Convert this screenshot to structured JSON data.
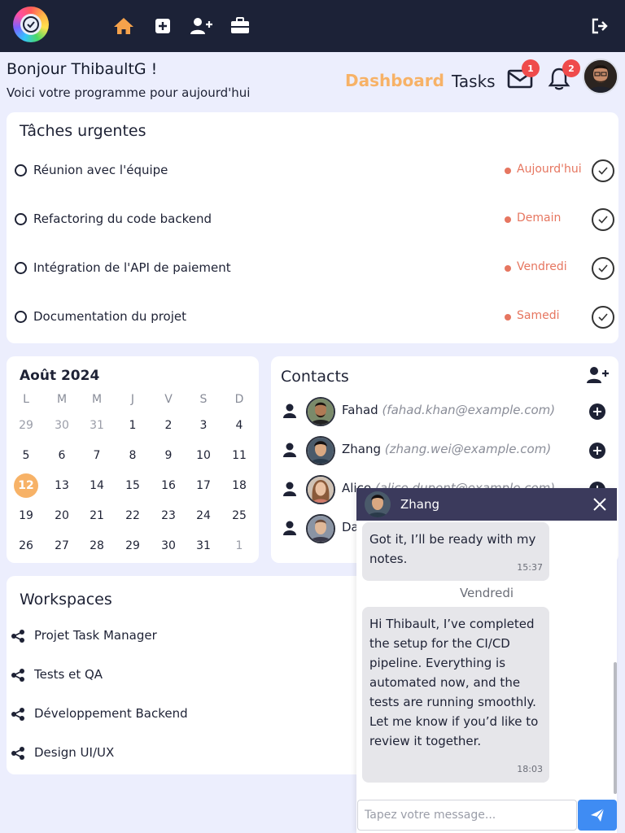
{
  "navbar": {
    "icons": [
      "logo-icon",
      "home-icon",
      "add-square-icon",
      "add-user-icon",
      "briefcase-icon",
      "logout-icon"
    ]
  },
  "header": {
    "greeting": "Bonjour ThibaultG !",
    "subtitle": "Voici votre programme pour aujourd'hui",
    "nav_dashboard": "Dashboard",
    "nav_tasks": "Tasks",
    "mail_badge": "1",
    "notif_badge": "2"
  },
  "urgent": {
    "title": "Tâches urgentes",
    "tasks": [
      {
        "label": "Réunion avec l'équipe",
        "date": "Aujourd'hui"
      },
      {
        "label": "Refactoring du code backend",
        "date": "Demain"
      },
      {
        "label": "Intégration de l'API de paiement",
        "date": "Vendredi"
      },
      {
        "label": "Documentation du projet",
        "date": "Samedi"
      }
    ]
  },
  "calendar": {
    "title": "Août 2024",
    "weekdays": [
      "L",
      "M",
      "M",
      "J",
      "V",
      "S",
      "D"
    ],
    "weeks": [
      [
        "29",
        "30",
        "31",
        "1",
        "2",
        "3",
        "4"
      ],
      [
        "5",
        "6",
        "7",
        "8",
        "9",
        "10",
        "11"
      ],
      [
        "12",
        "13",
        "14",
        "15",
        "16",
        "17",
        "18"
      ],
      [
        "19",
        "20",
        "21",
        "22",
        "23",
        "24",
        "25"
      ],
      [
        "26",
        "27",
        "28",
        "29",
        "30",
        "31",
        "1"
      ]
    ],
    "today": "12"
  },
  "contacts": {
    "title": "Contacts",
    "items": [
      {
        "name": "Fahad",
        "email": "(fahad.khan@example.com)"
      },
      {
        "name": "Zhang",
        "email": "(zhang.wei@example.com)"
      },
      {
        "name": "Alice",
        "email": "(alice.dupont@example.com)"
      },
      {
        "name": "Da",
        "email": ""
      }
    ]
  },
  "workspaces": {
    "title": "Workspaces",
    "items": [
      "Projet Task Manager",
      "Tests et QA",
      "Développement Backend",
      "Design UI/UX"
    ]
  },
  "chat": {
    "name": "Zhang",
    "messages": [
      {
        "text": "Got it, I’ll be ready with my notes.",
        "time": "15:37"
      },
      {
        "text": "Hi Thibault, I’ve completed the setup for the CI/CD pipeline. Everything is automated now, and the tests are running smoothly. Let me know if you’d like to review it together.",
        "time": "18:03"
      }
    ],
    "day_separator": "Vendredi",
    "input_placeholder": "Tapez votre message..."
  }
}
